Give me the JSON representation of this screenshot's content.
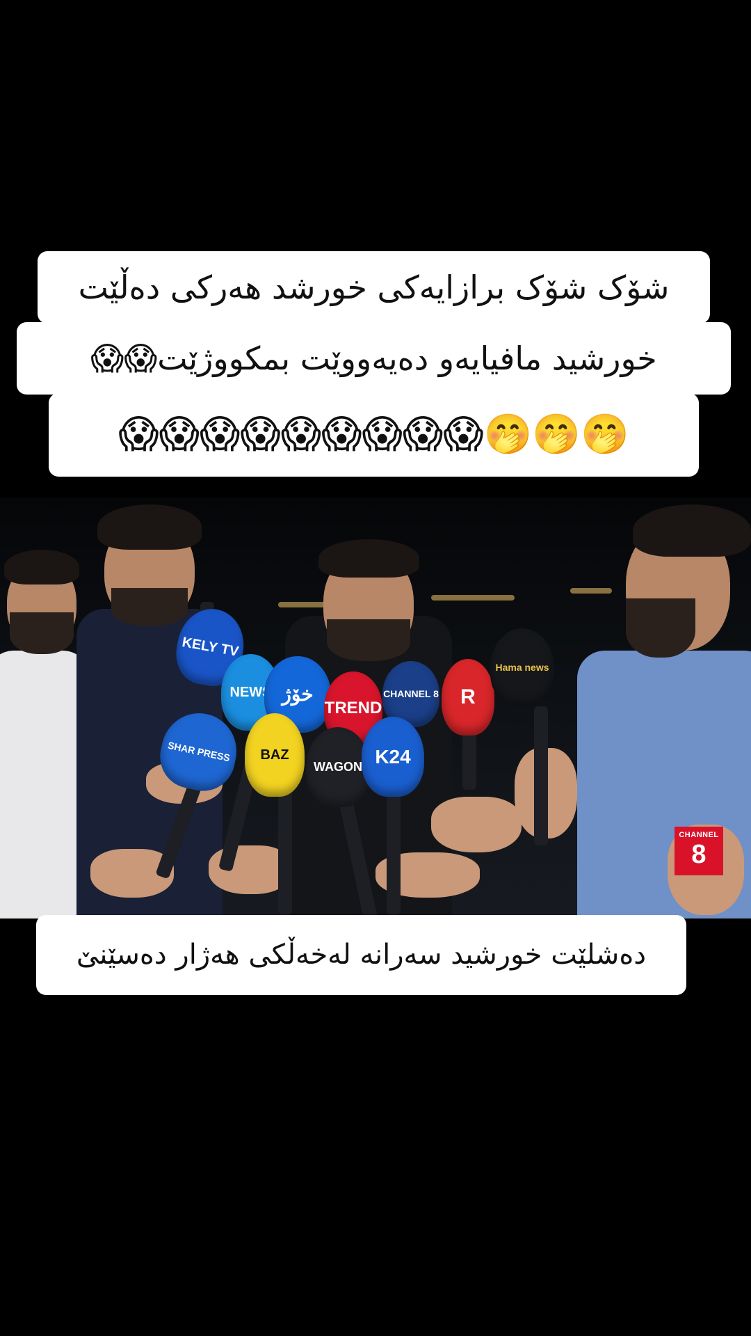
{
  "captions": {
    "line1": "شۆک شۆک برازایەکی خورشد هەرکی دەڵێت",
    "line2": "خورشید مافیایەو دەیەووێت بمکووژێت😱😱",
    "line3": "🤭🤭🤭😱😱😱😱😱😱😱😱😱",
    "bottom": "دەشلێت خورشید سەرانە لەخەڵکی هەژار دەسێنێ"
  },
  "microphones": [
    {
      "label": "KELY TV",
      "color": "#1a55c8"
    },
    {
      "label": "NEWS",
      "color": "#1b8ee0"
    },
    {
      "label": "خۆژ",
      "color": "#1467d8"
    },
    {
      "label": "TREND",
      "color": "#d8152c"
    },
    {
      "label": "CHANNEL 8",
      "color": "#1b3f88"
    },
    {
      "label": "R",
      "color": "#d8262a"
    },
    {
      "label": "Hama news",
      "color": "#15171b"
    },
    {
      "label": "SHAR PRESS",
      "color": "#1e66d2"
    },
    {
      "label": "BAZ",
      "color": "#f2d321"
    },
    {
      "label": "WAGON",
      "color": "#1f2126"
    },
    {
      "label": "K24",
      "color": "#1a5fd0"
    }
  ],
  "watermark": {
    "top": "CHANNEL",
    "number": "8",
    "color": "#d9122a"
  }
}
